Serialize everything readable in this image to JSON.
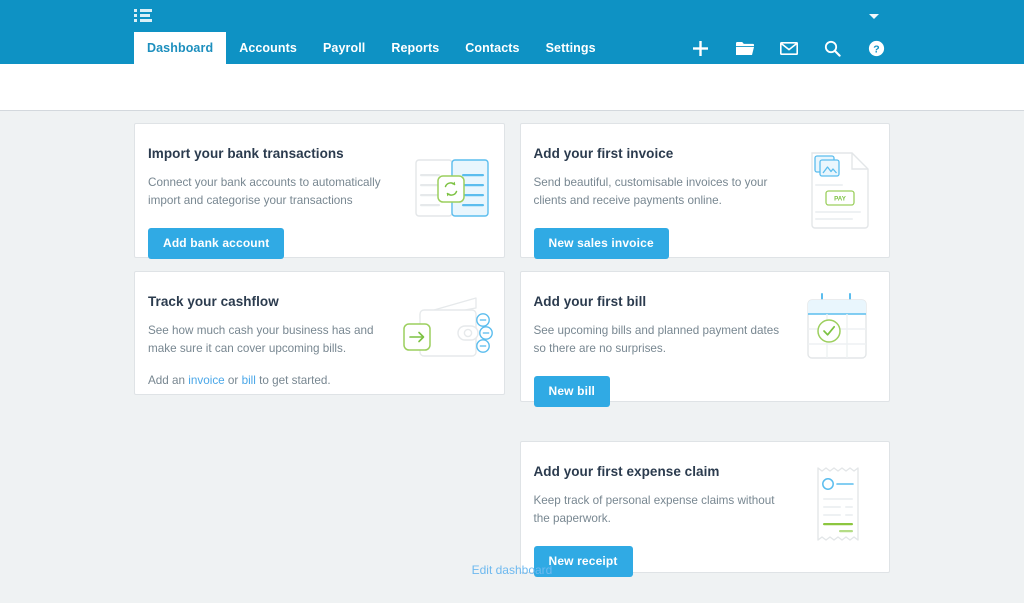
{
  "header": {
    "org_menu_icon": "list-icon",
    "account_caret_icon": "chevron-down-icon",
    "tabs": [
      {
        "label": "Dashboard",
        "active": true
      },
      {
        "label": "Accounts",
        "active": false
      },
      {
        "label": "Payroll",
        "active": false
      },
      {
        "label": "Reports",
        "active": false
      },
      {
        "label": "Contacts",
        "active": false
      },
      {
        "label": "Settings",
        "active": false
      }
    ],
    "icons": [
      {
        "name": "plus-icon",
        "title": "Add"
      },
      {
        "name": "folder-icon",
        "title": "Files"
      },
      {
        "name": "envelope-icon",
        "title": "Messages"
      },
      {
        "name": "search-icon",
        "title": "Search"
      },
      {
        "name": "help-icon",
        "title": "Help"
      }
    ]
  },
  "cards": {
    "bank": {
      "title": "Import your bank transactions",
      "body": "Connect your bank accounts to automatically import and categorise your transactions",
      "button": "Add bank account",
      "art": "bank-sync-illustration"
    },
    "invoice": {
      "title": "Add your first invoice",
      "body": "Send beautiful, customisable invoices to your clients and receive payments online.",
      "button": "New sales invoice",
      "art": "invoice-document-illustration",
      "art_label": "PAY"
    },
    "cashflow": {
      "title": "Track your cashflow",
      "body": "See how much cash your business has and make sure it can cover upcoming bills.",
      "note_prefix": "Add an ",
      "note_link1": "invoice",
      "note_middle": " or ",
      "note_link2": "bill",
      "note_suffix": " to get started.",
      "art": "wallet-illustration"
    },
    "bill": {
      "title": "Add your first bill",
      "body": "See upcoming bills and planned payment dates so there are no surprises.",
      "button": "New bill",
      "art": "calendar-check-illustration"
    },
    "expense": {
      "title": "Add your first expense claim",
      "body": "Keep track of personal expense claims without the paperwork.",
      "button": "New receipt",
      "art": "receipt-illustration"
    }
  },
  "footer": {
    "edit_dashboard": "Edit dashboard"
  },
  "colors": {
    "header_blue": "#0e92c4",
    "button_blue": "#30aae4",
    "link_blue": "#4aa7e8",
    "page_bg": "#eff2f3",
    "title_text": "#2b3b4e",
    "body_text": "#788791",
    "accent_green": "#8cc63f"
  }
}
